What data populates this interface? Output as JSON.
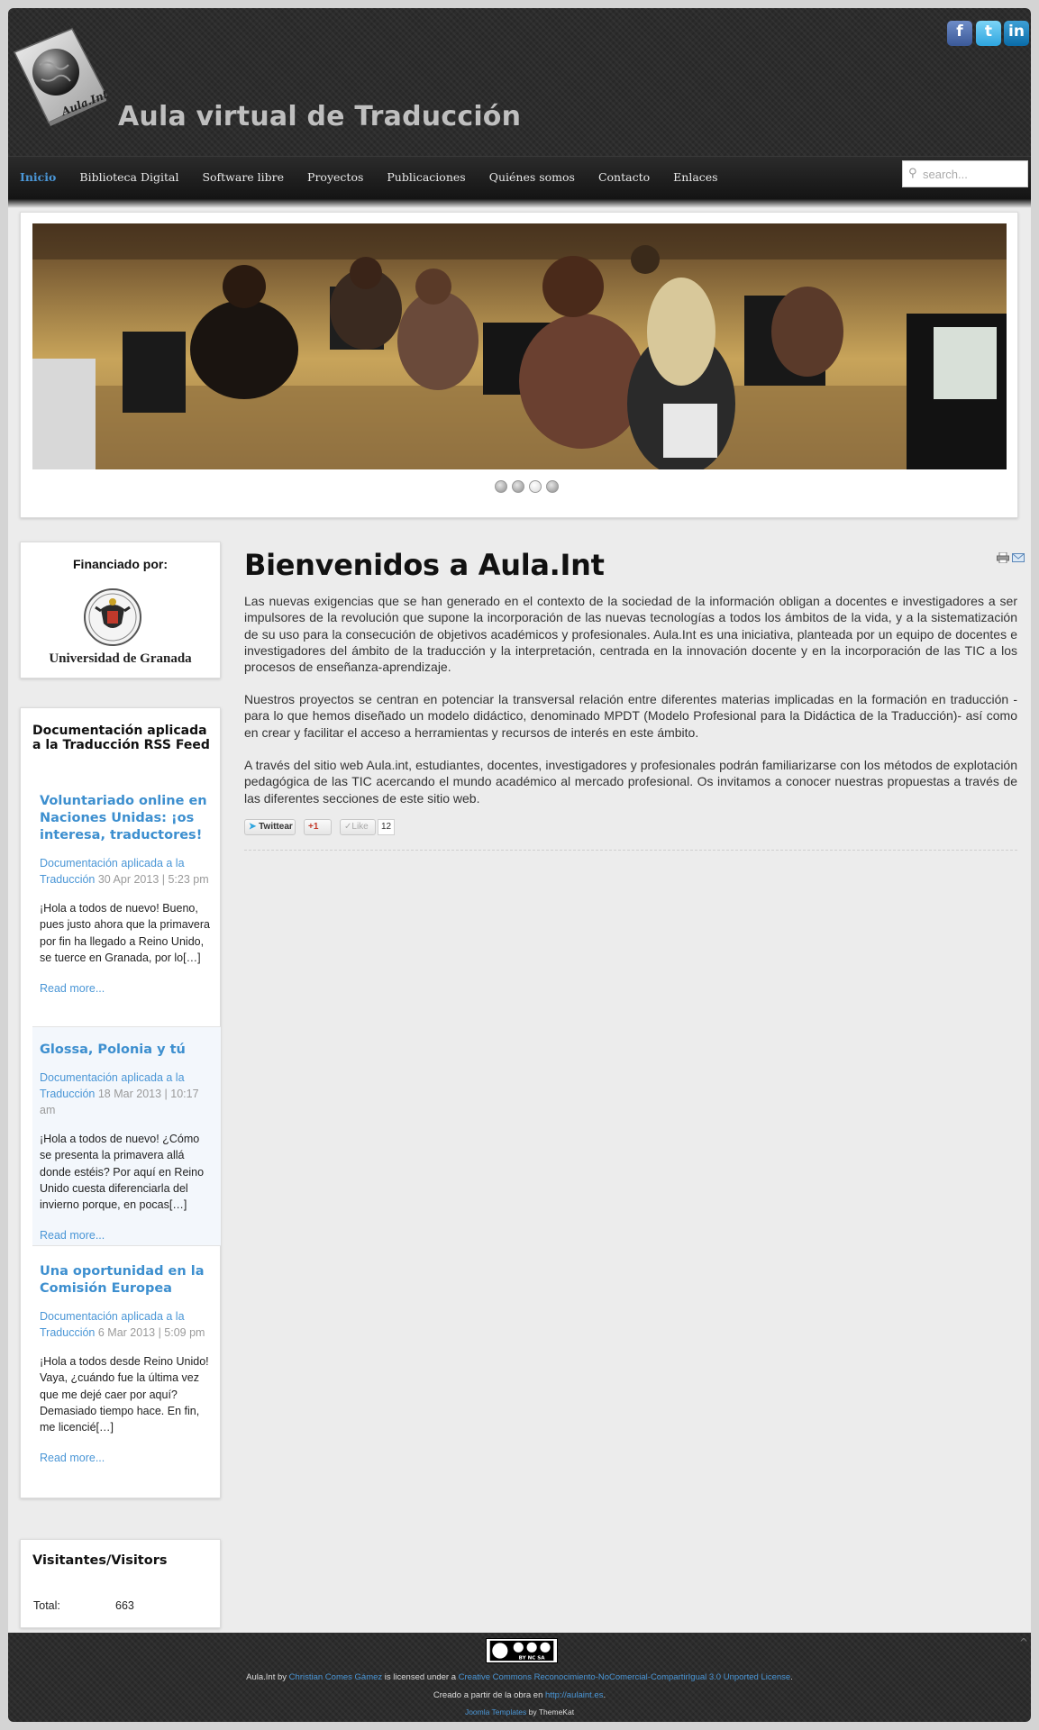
{
  "header": {
    "site_title": "Aula virtual de Traducción",
    "logo_text": "Aula.Int",
    "social": [
      {
        "name": "facebook",
        "glyph": "f"
      },
      {
        "name": "twitter",
        "glyph": "t"
      },
      {
        "name": "linkedin",
        "glyph": "in"
      }
    ]
  },
  "nav": {
    "items": [
      "Inicio",
      "Biblioteca Digital",
      "Software libre",
      "Proyectos",
      "Publicaciones",
      "Quiénes somos",
      "Contacto",
      "Enlaces"
    ],
    "active": "Inicio",
    "search_placeholder": "search..."
  },
  "slideshow": {
    "dot_count": 4,
    "active_dot": 3
  },
  "sidebar": {
    "funding": {
      "title": "Financiado por:",
      "org": "Universidad de Granada"
    },
    "rss": {
      "title": "Documentación aplicada a la Traducción RSS Feed",
      "items": [
        {
          "title": "Voluntariado online en Naciones Unidas: ¡os interesa, traductores!",
          "category": "Documentación aplicada a la Traducción",
          "date": "30 Apr 2013 | 5:23 pm",
          "excerpt": "¡Hola a todos de nuevo! Bueno, pues justo ahora que la primavera por fin ha llegado a Reino Unido, se tuerce en Granada, por lo[…]",
          "more": "Read more..."
        },
        {
          "title": "Glossa, Polonia y tú",
          "category": "Documentación aplicada a la Traducción",
          "date": "18 Mar 2013 | 10:17 am",
          "excerpt": "¡Hola a todos de nuevo! ¿Cómo se presenta la primavera allá donde estéis? Por aquí en Reino Unido cuesta diferenciarla del invierno porque, en pocas[…]",
          "more": "Read more..."
        },
        {
          "title": "Una oportunidad en la Comisión Europea",
          "category": "Documentación aplicada a la Traducción",
          "date": "6 Mar 2013 | 5:09 pm",
          "excerpt": "¡Hola a todos desde Reino Unido! Vaya, ¿cuándo fue la última vez que me dejé caer por aquí? Demasiado tiempo hace. En fin, me licencié[…]",
          "more": "Read more..."
        }
      ]
    },
    "visitors": {
      "title": "Visitantes/Visitors",
      "label": "Total:",
      "value": "663"
    }
  },
  "article": {
    "title": "Bienvenidos a Aula.Int",
    "paragraphs": [
      "Las nuevas exigencias que se han generado en el contexto de la sociedad de la información obligan a docentes e investigadores a ser impulsores de la revolución que supone la incorporación de las nuevas tecnologías a todos los ámbitos de la vida, y a la sistematización de su uso para la consecución de objetivos académicos y profesionales. Aula.Int es una iniciativa, planteada por un equipo de docentes e investigadores del ámbito de la traducción y la interpretación, centrada en la innovación docente y en la incorporación de las TIC a los procesos de enseñanza-aprendizaje.",
      "Nuestros proyectos se centran en potenciar la transversal relación entre diferentes materias implicadas en la formación en traducción -para lo que hemos diseñado un modelo didáctico, denominado MPDT (Modelo Profesional para la Didáctica de la Traducción)- así como en crear y facilitar el acceso a herramientas y recursos de interés en este ámbito.",
      "A través del sitio web Aula.int, estudiantes, docentes, investigadores y profesionales podrán familiarizarse con los métodos de explotación pedagógica de las TIC acercando el mundo académico al mercado profesional. Os invitamos a conocer nuestras propuestas a través de las diferentes secciones de este sitio web."
    ],
    "share": {
      "tweet": "Twittear",
      "gplus": "+1",
      "like": "Like",
      "like_count": "12"
    }
  },
  "footer": {
    "cc_badge": "BY NC SA",
    "line1_pre": "Aula.Int by ",
    "author": "Christian Comes Gámez",
    "line1_mid": " is licensed under a ",
    "license": "Creative Commons Reconocimiento-NoComercial-CompartirIgual 3.0 Unported License",
    "line1_post": ".",
    "line2_pre": "Creado a partir de la obra en ",
    "line2_link": "http://aulaint.es",
    "line2_post": ".",
    "line3_link": "Joomla Templates",
    "line3_post": " by ThemeKat",
    "scroll_top": "^"
  },
  "colors": {
    "accent": "#4a96d6",
    "header_bg": "#2c2c2c",
    "body_bg": "#ececec"
  }
}
